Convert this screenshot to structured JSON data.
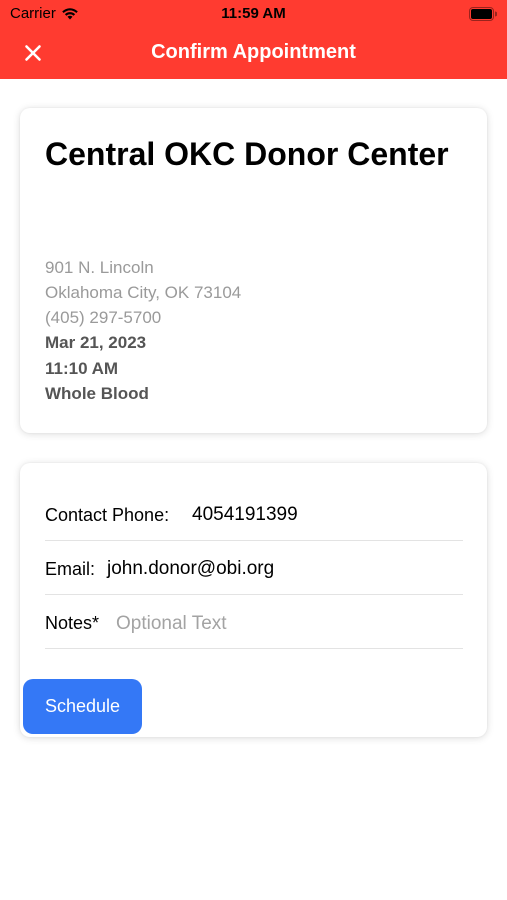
{
  "status_bar": {
    "carrier": "Carrier",
    "time": "11:59 AM"
  },
  "nav": {
    "title": "Confirm Appointment",
    "close_icon": "close-icon",
    "background_color": "#ff3b30"
  },
  "center": {
    "name": "Central OKC Donor Center",
    "address_line1": "901 N. Lincoln",
    "address_line2": "Oklahoma City, OK 73104",
    "phone": "(405) 297-5700",
    "date": "Mar 21, 2023",
    "time": "11:10 AM",
    "donation_type": "Whole Blood"
  },
  "form": {
    "contact_phone_label": "Contact Phone:",
    "contact_phone_value": "4054191399",
    "email_label": "Email:",
    "email_value": "john.donor@obi.org",
    "notes_label": "Notes*",
    "notes_placeholder": "Optional Text",
    "notes_value": ""
  },
  "actions": {
    "schedule_label": "Schedule",
    "schedule_color": "#3478f6"
  }
}
